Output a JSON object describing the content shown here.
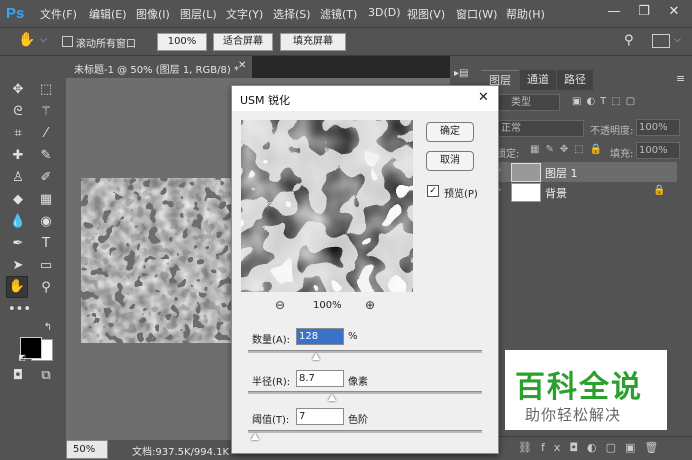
{
  "app": {
    "logo": "Ps"
  },
  "menu": [
    "文件(F)",
    "编辑(E)",
    "图像(I)",
    "图层(L)",
    "文字(Y)",
    "选择(S)",
    "滤镜(T)",
    "3D(D)",
    "视图(V)",
    "窗口(W)",
    "帮助(H)"
  ],
  "window_controls": {
    "minimize": "—",
    "restore": "❐",
    "close": "✕"
  },
  "options": {
    "scroll_all": "滚动所有窗口",
    "zoom_100": "100%",
    "fit_screen": "适合屏幕",
    "fill_screen": "填充屏幕"
  },
  "document": {
    "tab_title": "未标题-1 @ 50% (图层 1, RGB/8) *",
    "zoom": "50%",
    "doc_info": "文档:937.5K/994.1K"
  },
  "panels": {
    "tabs": [
      "图层",
      "通道",
      "路径"
    ],
    "kind_filter": "类型",
    "blend_mode": "正常",
    "opacity_label": "不透明度:",
    "opacity_value": "100%",
    "lock_label": "锁定:",
    "fill_label": "填充:",
    "fill_value": "100%",
    "layers": [
      {
        "name": "图层 1"
      },
      {
        "name": "背景"
      }
    ]
  },
  "dialog": {
    "title": "USM 锐化",
    "ok": "确定",
    "cancel": "取消",
    "preview_label": "预览(P)",
    "preview_checked": true,
    "zoom_level": "100%",
    "amount": {
      "label": "数量(A):",
      "value": "128",
      "unit": "%",
      "slider": 0.29
    },
    "radius": {
      "label": "半径(R):",
      "value": "8.7",
      "unit": "像素",
      "slider": 0.36
    },
    "threshold": {
      "label": "阈值(T):",
      "value": "7",
      "unit": "色阶",
      "slider": 0.03
    }
  },
  "watermark": {
    "title": "百科全说",
    "subtitle": "助你轻松解决",
    "color": "#2ca02c"
  }
}
